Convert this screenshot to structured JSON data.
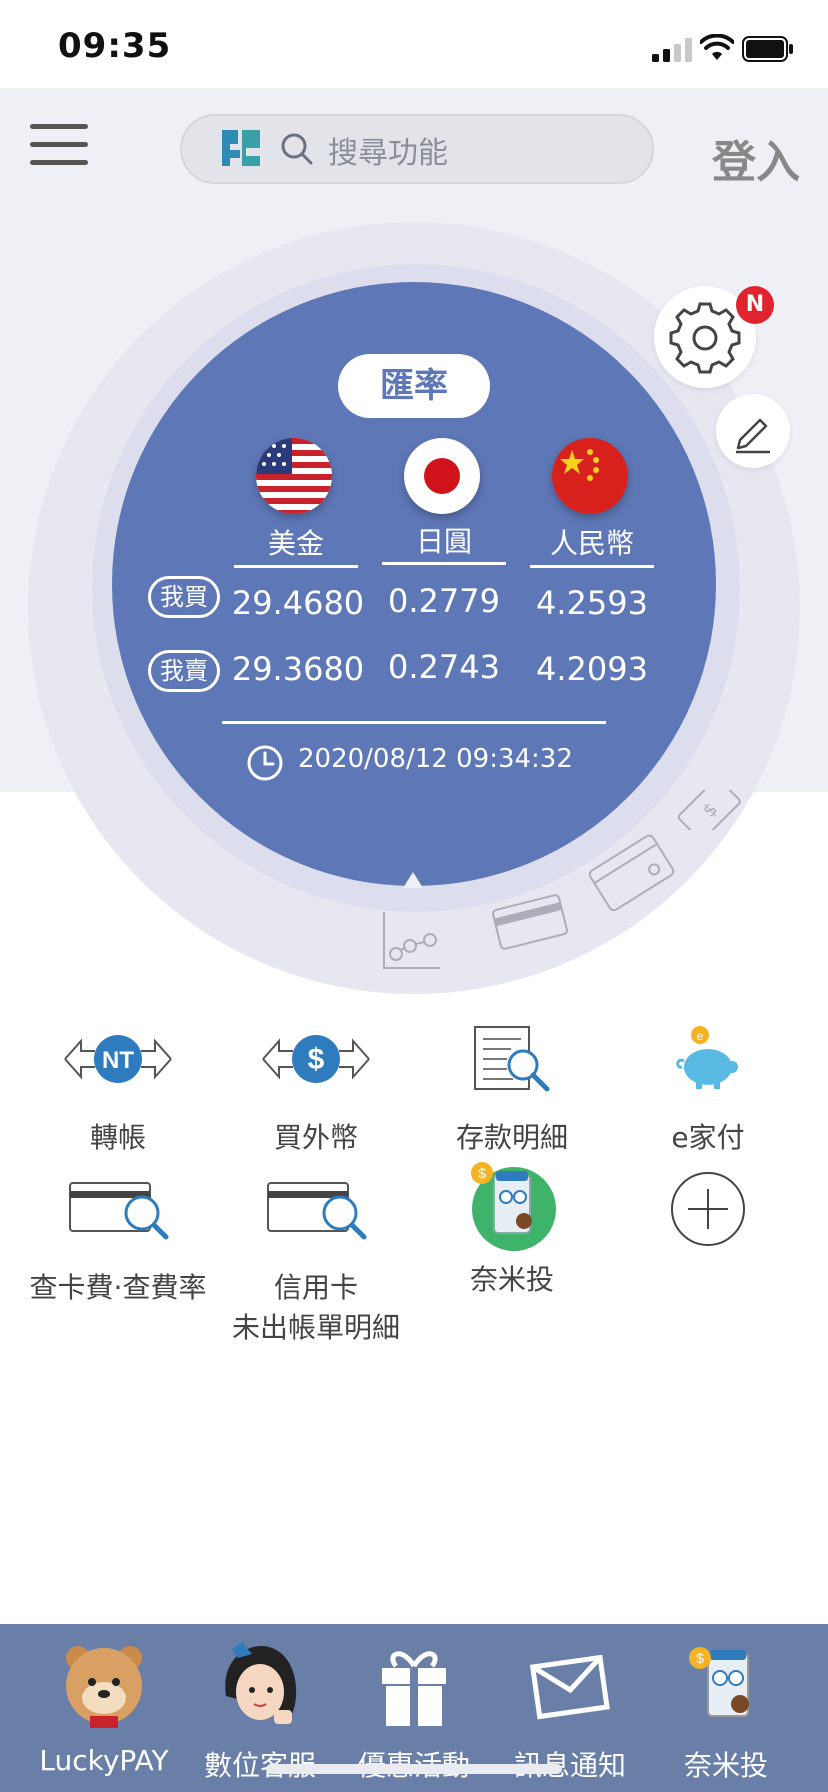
{
  "status_bar": {
    "time": "09:35"
  },
  "header": {
    "search_placeholder": "搜尋功能",
    "login_label": "登入"
  },
  "rates": {
    "title": "匯率",
    "badge": "N",
    "currencies": [
      {
        "label": "美金",
        "buy": "29.4680",
        "sell": "29.3680"
      },
      {
        "label": "日圓",
        "buy": "0.2779",
        "sell": "0.2743"
      },
      {
        "label": "人民幣",
        "buy": "4.2593",
        "sell": "4.2093"
      }
    ],
    "buy_label": "我買",
    "sell_label": "我賣",
    "timestamp": "2020/08/12 09:34:32"
  },
  "functions": [
    {
      "label": "轉帳",
      "icon": "nt-transfer-icon"
    },
    {
      "label": "買外幣",
      "icon": "dollar-exchange-icon"
    },
    {
      "label": "存款明細",
      "icon": "document-search-icon"
    },
    {
      "label": "e家付",
      "icon": "piggy-bank-icon"
    },
    {
      "label": "查卡費·查費率",
      "icon": "card-search-icon"
    },
    {
      "label": "信用卡\n未出帳單明細",
      "label_line1": "信用卡",
      "label_line2": "未出帳單明細",
      "icon": "card-search-icon"
    },
    {
      "label": "奈米投",
      "icon": "nano-invest-icon"
    },
    {
      "label": "",
      "icon": "add-icon"
    }
  ],
  "bottom_nav": [
    {
      "label": "LuckyPAY",
      "icon": "bear-mascot-icon"
    },
    {
      "label": "數位客服",
      "icon": "service-agent-icon"
    },
    {
      "label": "優惠活動",
      "icon": "gift-icon"
    },
    {
      "label": "訊息通知",
      "icon": "mail-icon"
    },
    {
      "label": "奈米投",
      "icon": "nano-invest-icon"
    }
  ],
  "colors": {
    "accent_blue": "#5e77b6",
    "nav_bg": "#6a7fa8",
    "badge_red": "#e0232c",
    "icon_blue": "#2e7bbd"
  }
}
